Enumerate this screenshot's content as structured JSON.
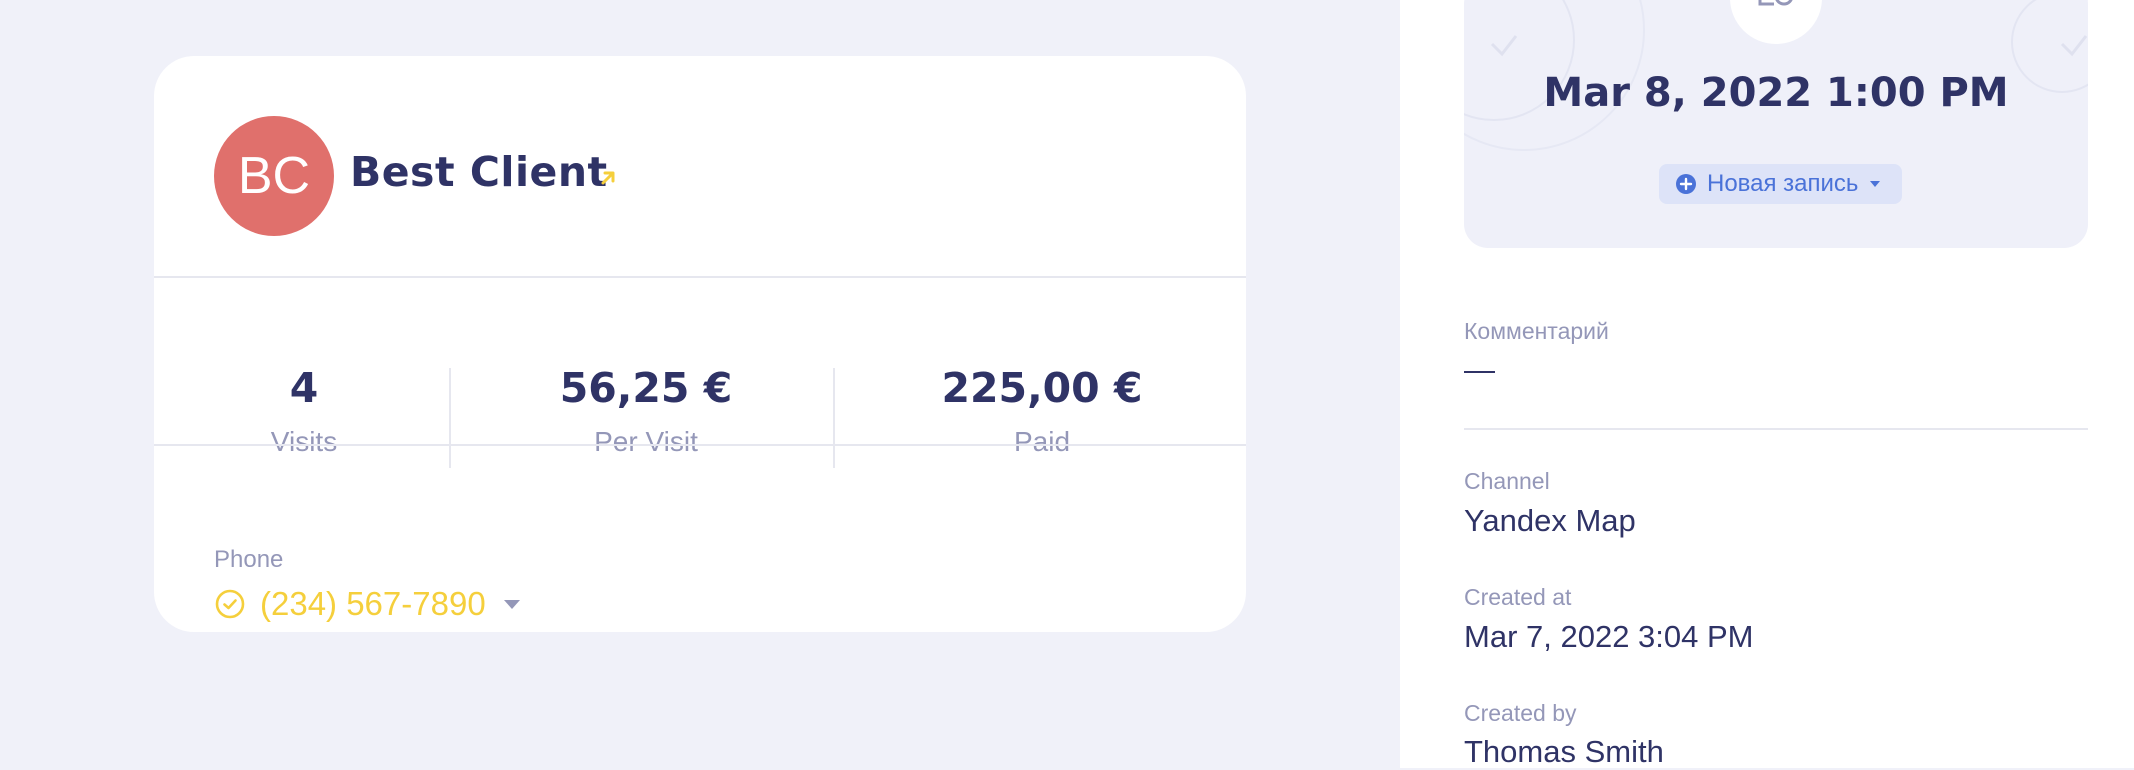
{
  "client": {
    "initials": "BC",
    "name": "Best Client",
    "avatar_color": "#e0706c",
    "link_icon": "arrow-up-right-icon"
  },
  "stats": [
    {
      "value": "4",
      "label": "Visits"
    },
    {
      "value": "56,25 €",
      "label": "Per Visit"
    },
    {
      "value": "225,00 €",
      "label": "Paid"
    }
  ],
  "phone": {
    "label": "Phone",
    "value": "(234) 567-7890",
    "status_icon": "check-circle-icon",
    "accent_color": "#f5cf3c"
  },
  "appointment": {
    "datetime": "Mar 8, 2022 1:00 PM",
    "new_entry_label": "Новая запись"
  },
  "details": {
    "comment_label": "Комментарий",
    "comment_value": "—",
    "channel_label": "Channel",
    "channel_value": "Yandex Map",
    "created_at_label": "Created at",
    "created_at_value": "Mar 7, 2022 3:04 PM",
    "created_by_label": "Created by",
    "created_by_value": "Thomas Smith"
  },
  "colors": {
    "background": "#f0f1f9",
    "text_primary": "#2f3366",
    "text_muted": "#9497b8",
    "link_blue": "#4a72d8"
  }
}
